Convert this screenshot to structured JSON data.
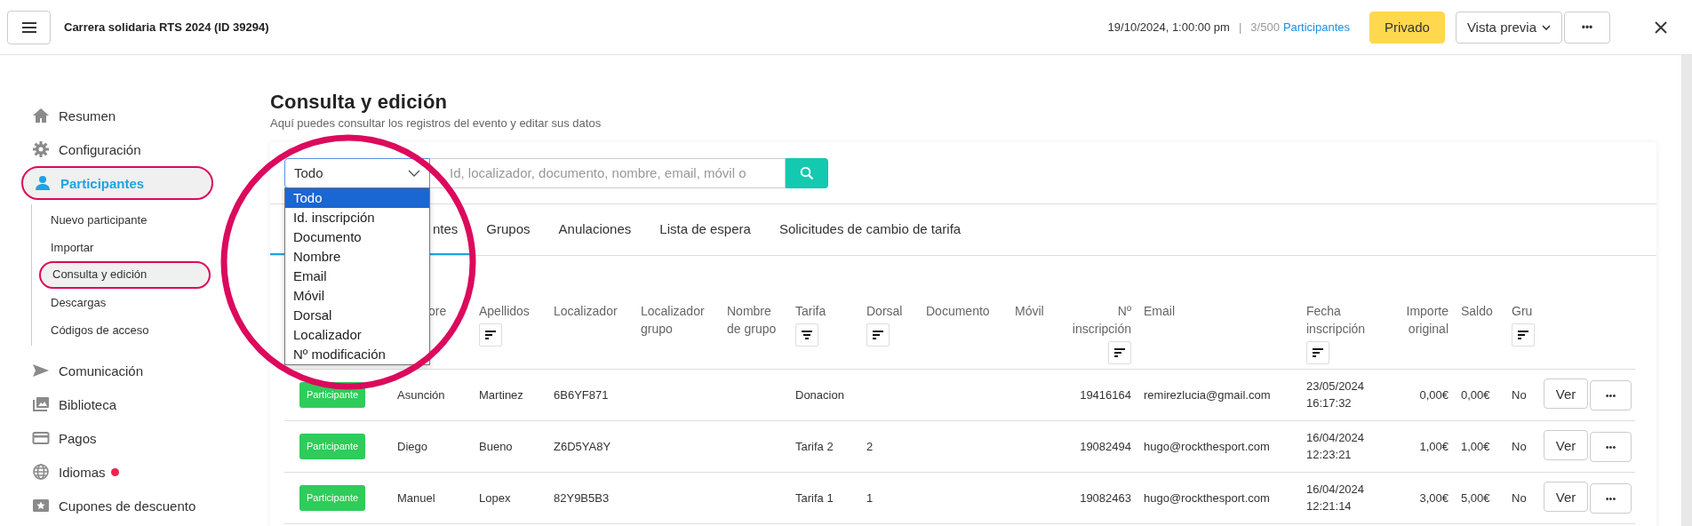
{
  "topbar": {
    "title": "Carrera solidaria RTS 2024 (ID 39294)",
    "datetime": "19/10/2024, 1:00:00 pm",
    "separator": "|",
    "count": "3/500",
    "count_label": "Participantes",
    "buttons": [
      {
        "kind": "primary",
        "label": "Privado"
      },
      {
        "kind": "dropdown",
        "label": "Vista previa"
      },
      {
        "kind": "more",
        "label": "•••"
      }
    ]
  },
  "sidebar": {
    "items": [
      {
        "label": "Resumen",
        "selected": false,
        "circled": false
      },
      {
        "label": "Configuración",
        "selected": false,
        "circled": false
      },
      {
        "label": "Participantes",
        "selected": true,
        "circled": true,
        "children": [
          {
            "label": "Nuevo participante",
            "selected": false,
            "circled": false
          },
          {
            "label": "Importar",
            "selected": false,
            "circled": false
          },
          {
            "label": "Consulta y edición",
            "selected": true,
            "circled": true
          },
          {
            "label": "Descargas",
            "selected": false,
            "circled": false
          },
          {
            "label": "Códigos de acceso",
            "selected": false,
            "circled": false
          }
        ]
      },
      {
        "label": "Comunicación",
        "selected": false,
        "circled": false
      },
      {
        "label": "Biblioteca",
        "selected": false,
        "circled": false
      },
      {
        "label": "Pagos",
        "selected": false,
        "circled": false
      },
      {
        "label": "Idiomas",
        "selected": false,
        "circled": false,
        "alert": true
      },
      {
        "label": "Cupones de descuento",
        "selected": false,
        "circled": false
      }
    ]
  },
  "page": {
    "title": "Consulta y edición",
    "subtitle": "Aquí puedes consultar los registros del evento y editar sus datos"
  },
  "search": {
    "filter": {
      "value": "Todo",
      "expanded": true,
      "options": [
        {
          "label": "Todo",
          "selected": true
        },
        {
          "label": "Id. inscripción",
          "selected": false
        },
        {
          "label": "Documento",
          "selected": false
        },
        {
          "label": "Nombre",
          "selected": false
        },
        {
          "label": "Email",
          "selected": false
        },
        {
          "label": "Móvil",
          "selected": false
        },
        {
          "label": "Dorsal",
          "selected": false
        },
        {
          "label": "Localizador",
          "selected": false
        },
        {
          "label": "Nº modificación",
          "selected": false
        }
      ]
    },
    "placeholder": "Id, localizador, documento, nombre, email, móvil o"
  },
  "tabs": [
    {
      "label": "ntes",
      "selected": true
    },
    {
      "label": "Grupos",
      "selected": false
    },
    {
      "label": "Anulaciones",
      "selected": false
    },
    {
      "label": "Lista de espera",
      "selected": false
    },
    {
      "label": "Solicitudes de cambio de tarifa",
      "selected": false
    }
  ],
  "table": {
    "columns": [
      {
        "label": "ore"
      },
      {
        "label": "Apellidos",
        "sortable": true
      },
      {
        "label": "Localizador"
      },
      {
        "label": "Localizador grupo"
      },
      {
        "label": "Nombre de grupo"
      },
      {
        "label": "Tarifa",
        "filterable": true
      },
      {
        "label": "Dorsal",
        "sortable": true
      },
      {
        "label": "Documento"
      },
      {
        "label": "Móvil"
      },
      {
        "label": "Nº inscripción",
        "sortable": true
      },
      {
        "label": "Email"
      },
      {
        "label": "Fecha inscripción",
        "sortable": true
      },
      {
        "label": "Importe original"
      },
      {
        "label": "Saldo"
      },
      {
        "label": "Gru",
        "sortable": true
      }
    ],
    "rows": [
      {
        "status": "Participante",
        "cells": [
          "Asunción",
          "Martinez",
          "6B6YF871",
          null,
          null,
          "Donacion",
          null,
          null,
          null,
          "19416164",
          "remirezlucia@gmail.com",
          "23/05/2024 16:17:32",
          "0,00€",
          "0,00€",
          "No"
        ],
        "actions": [
          "Ver",
          "•••"
        ]
      },
      {
        "status": "Participante",
        "cells": [
          "Diego",
          "Bueno",
          "Z6D5YA8Y",
          null,
          null,
          "Tarifa 2",
          "2",
          null,
          null,
          "19082494",
          "hugo@rockthesport.com",
          "16/04/2024 12:23:21",
          "1,00€",
          "1,00€",
          "No"
        ],
        "actions": [
          "Ver",
          "•••"
        ]
      },
      {
        "status": "Participante",
        "cells": [
          "Manuel",
          "Lopex",
          "82Y9B5B3",
          null,
          null,
          "Tarifa 1",
          "1",
          null,
          null,
          "19082463",
          "hugo@rockthesport.com",
          "16/04/2024 12:21:14",
          "3,00€",
          "5,00€",
          "No"
        ],
        "actions": [
          "Ver",
          "•••"
        ]
      }
    ]
  }
}
